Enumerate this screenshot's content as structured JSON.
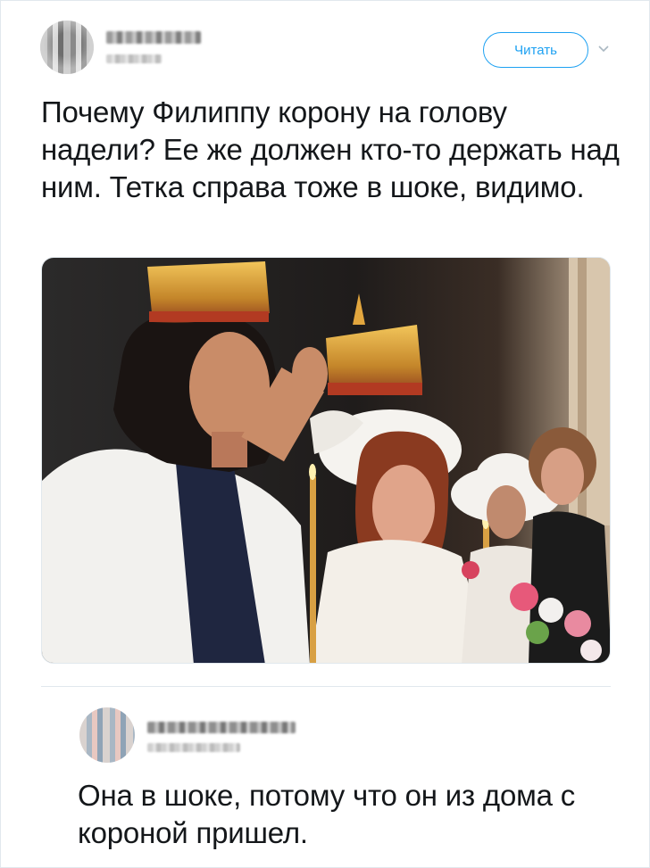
{
  "tweet": {
    "author_name_visible": false,
    "follow_label": "Читать",
    "text": "Почему Филиппу корону на голову надели? Ее же должен кто-то держать над ним. Тетка справа тоже в шоке, видимо."
  },
  "reply": {
    "author_name_visible": false,
    "text": "Она в шоке, потому что он из дома с короной пришел."
  },
  "colors": {
    "accent": "#1da1f2",
    "text": "#14171a",
    "border": "#e1e8ed"
  },
  "icons": {
    "follow_menu": "chevron-down-icon"
  }
}
